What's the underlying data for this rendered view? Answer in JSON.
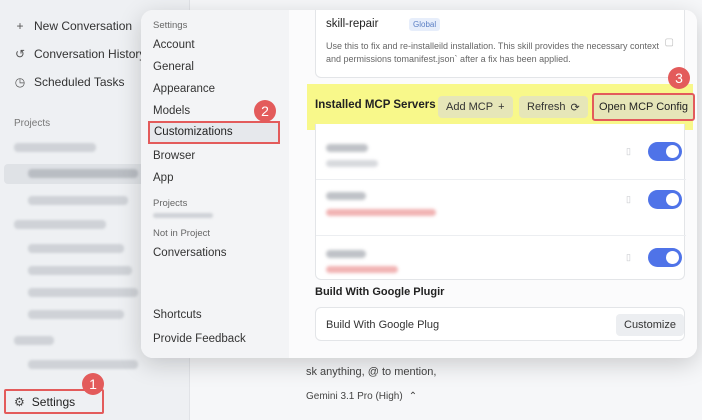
{
  "sidebar": {
    "new_conversation": "New Conversation",
    "conversation_history": "Conversation History",
    "scheduled_tasks": "Scheduled Tasks",
    "projects_label": "Projects",
    "settings_label": "Settings",
    "icons": {
      "new": "plus-icon",
      "history": "history-icon",
      "tasks": "clock-icon",
      "settings": "gear-icon"
    }
  },
  "chat": {
    "prompt_placeholder": "sk anything, @ to mention,",
    "model": "Gemini 3.1 Pro (High)"
  },
  "settings_nav": {
    "settings_heading": "Settings",
    "items": [
      "Account",
      "General",
      "Appearance",
      "Models",
      "Customizations",
      "Browser",
      "App"
    ],
    "projects_heading": "Projects",
    "not_in_project_heading": "Not in Project",
    "conversations": "Conversations",
    "shortcuts": "Shortcuts",
    "provide_feedback": "Provide Feedback",
    "active_item": "Customizations"
  },
  "skill": {
    "name": "skill-repair",
    "badge": "Global",
    "description": "Use this to fix and re-installeild installation. This skill provides the necessary context and permissions tomanifest.json` after a fix has been applied."
  },
  "mcp": {
    "title": "Installed MCP Servers",
    "add_label": "Add MCP",
    "refresh_label": "Refresh",
    "open_config_label": "Open MCP Config",
    "servers": [
      {
        "enabled": true
      },
      {
        "enabled": true
      },
      {
        "enabled": true
      }
    ]
  },
  "build": {
    "title": "Build With Google Plugir",
    "item_label": "Build With Google Plug",
    "customize_label": "Customize"
  },
  "callouts": {
    "one": "1",
    "two": "2",
    "three": "3"
  },
  "colors": {
    "highlight": "#f8f88a",
    "callout": "#e35b5b",
    "toggle_on": "#4f73e8"
  }
}
